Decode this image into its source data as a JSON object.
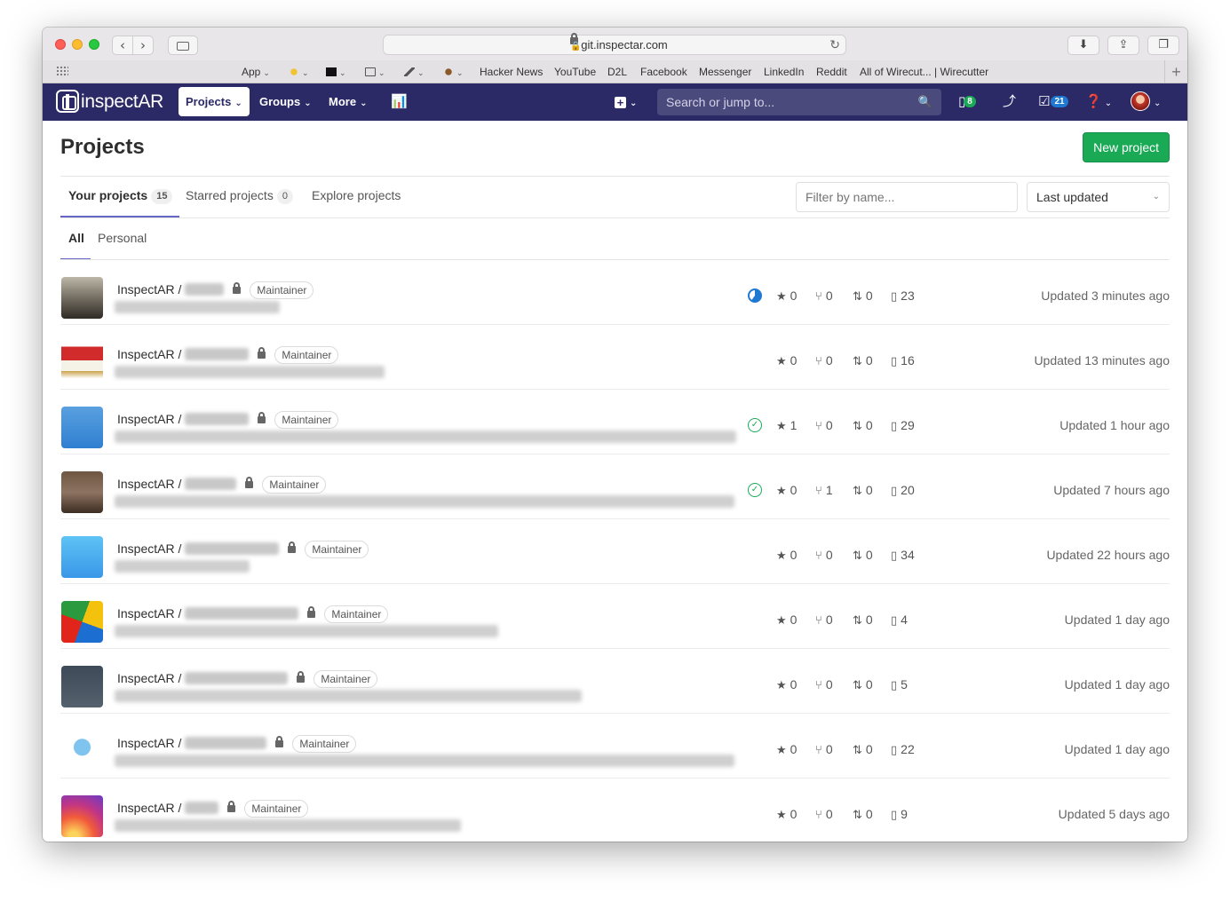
{
  "browser": {
    "url": "git.inspectar.com",
    "favorites": [
      {
        "label": "App",
        "dropdown": true
      },
      {
        "label": "",
        "icon": "lightbulb-icon",
        "dropdown": true
      },
      {
        "label": "",
        "icon": "black-square-icon",
        "dropdown": true
      },
      {
        "label": "",
        "icon": "book-icon",
        "dropdown": true
      },
      {
        "label": "",
        "icon": "microscope-icon",
        "dropdown": true
      },
      {
        "label": "",
        "icon": "dog-icon",
        "dropdown": true
      },
      {
        "label": "Hacker News"
      },
      {
        "label": "YouTube"
      },
      {
        "label": "D2L"
      },
      {
        "label": "Facebook"
      },
      {
        "label": "Messenger"
      },
      {
        "label": "LinkedIn"
      },
      {
        "label": "Reddit"
      },
      {
        "label": "All of Wirecut... | Wirecutter"
      }
    ]
  },
  "header": {
    "logo": "inspectAR",
    "nav": {
      "projects": "Projects",
      "groups": "Groups",
      "more": "More"
    },
    "search_placeholder": "Search or jump to...",
    "issues_count": "8",
    "todos_count": "21"
  },
  "page": {
    "title": "Projects",
    "new_project": "New project",
    "tabs": {
      "your": {
        "label": "Your projects",
        "count": "15"
      },
      "starred": {
        "label": "Starred projects",
        "count": "0"
      },
      "explore": {
        "label": "Explore projects"
      }
    },
    "filter_placeholder": "Filter by name...",
    "sort": "Last updated",
    "subtabs": {
      "all": "All",
      "personal": "Personal"
    }
  },
  "projects": [
    {
      "namespace": "InspectAR /",
      "role": "Maintainer",
      "ci": "running",
      "stars": "0",
      "forks": "0",
      "mrs": "0",
      "issues": "23",
      "updated": "Updated 3 minutes ago"
    },
    {
      "namespace": "InspectAR /",
      "role": "Maintainer",
      "ci": "",
      "stars": "0",
      "forks": "0",
      "mrs": "0",
      "issues": "16",
      "updated": "Updated 13 minutes ago"
    },
    {
      "namespace": "InspectAR /",
      "role": "Maintainer",
      "ci": "passed",
      "stars": "1",
      "forks": "0",
      "mrs": "0",
      "issues": "29",
      "updated": "Updated 1 hour ago"
    },
    {
      "namespace": "InspectAR /",
      "role": "Maintainer",
      "ci": "passed",
      "stars": "0",
      "forks": "1",
      "mrs": "0",
      "issues": "20",
      "updated": "Updated 7 hours ago"
    },
    {
      "namespace": "InspectAR /",
      "role": "Maintainer",
      "ci": "",
      "stars": "0",
      "forks": "0",
      "mrs": "0",
      "issues": "34",
      "updated": "Updated 22 hours ago"
    },
    {
      "namespace": "InspectAR /",
      "role": "Maintainer",
      "ci": "",
      "stars": "0",
      "forks": "0",
      "mrs": "0",
      "issues": "4",
      "updated": "Updated 1 day ago"
    },
    {
      "namespace": "InspectAR /",
      "role": "Maintainer",
      "ci": "",
      "stars": "0",
      "forks": "0",
      "mrs": "0",
      "issues": "5",
      "updated": "Updated 1 day ago"
    },
    {
      "namespace": "InspectAR /",
      "role": "Maintainer",
      "ci": "",
      "stars": "0",
      "forks": "0",
      "mrs": "0",
      "issues": "22",
      "updated": "Updated 1 day ago"
    },
    {
      "namespace": "InspectAR /",
      "role": "Maintainer",
      "ci": "",
      "stars": "0",
      "forks": "0",
      "mrs": "0",
      "issues": "9",
      "updated": "Updated 5 days ago"
    }
  ]
}
